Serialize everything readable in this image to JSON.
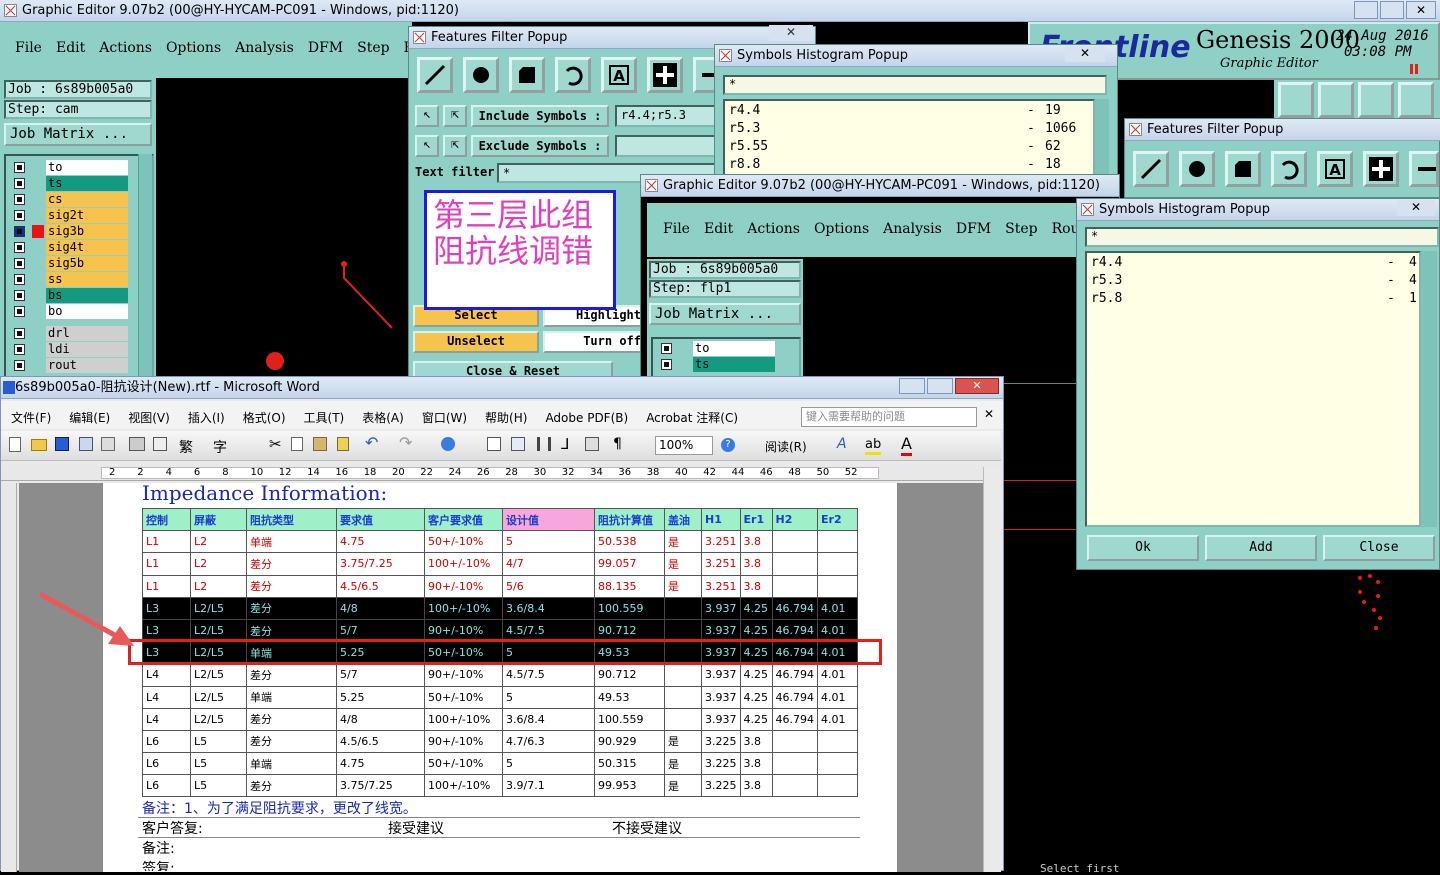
{
  "ge_main": {
    "title": "Graphic Editor 9.07b2 (00@HY-HYCAM-PC091 - Windows, pid:1120)",
    "menu": [
      "File",
      "Edit",
      "Actions",
      "Options",
      "Analysis",
      "DFM",
      "Step",
      "R"
    ],
    "job": "Job  :  6s89b005a0",
    "step": "Step:  cam",
    "job_matrix": "Job Matrix ...",
    "layers": [
      "to",
      "ts",
      "cs",
      "sig2t",
      "sig3b",
      "sig4t",
      "sig5b",
      "ss",
      "bs",
      "bo"
    ],
    "layers2": [
      "drl",
      "ldi",
      "rout"
    ]
  },
  "brand": {
    "logo": "Frontline",
    "product": "Genesis 2000",
    "subtitle": "Graphic Editor",
    "date": "24 Aug 2016",
    "time": "03:08 PM"
  },
  "ffp1": {
    "title": "Features Filter Popup",
    "include_label": "Include Symbols :",
    "include_value": "r4.4;r5.3",
    "exclude_label": "Exclude Symbols :",
    "text_filter_label": "Text filter",
    "text_filter_value": "*",
    "select": "Select",
    "highlight": "Highlight",
    "unselect": "Unselect",
    "turn_off": "Turn off",
    "close_reset": "Close & Reset"
  },
  "note": "第三层此组阻抗线调错",
  "hist1": {
    "title": "Symbols Histogram Popup",
    "filter": "*",
    "rows": [
      {
        "sym": "r4.4",
        "count": "19"
      },
      {
        "sym": "r5.3",
        "count": "1066"
      },
      {
        "sym": "r5.55",
        "count": "62"
      },
      {
        "sym": "r8.8",
        "count": "18"
      }
    ]
  },
  "ge2": {
    "title": "Graphic Editor 9.07b2 (00@HY-HYCAM-PC091 - Windows, pid:1120)",
    "menu": [
      "File",
      "Edit",
      "Actions",
      "Options",
      "Analysis",
      "DFM",
      "Step",
      "Rout"
    ],
    "job": "Job  :  6s89b005a0",
    "step": "Step:  flp1",
    "job_matrix": "Job Matrix ...",
    "layers": [
      "to",
      "ts"
    ]
  },
  "ffp2": {
    "title": "Features Filter Popup"
  },
  "hist2": {
    "title": "Symbols Histogram Popup",
    "filter": "*",
    "rows": [
      {
        "sym": "r4.4",
        "count": "4"
      },
      {
        "sym": "r5.3",
        "count": "4"
      },
      {
        "sym": "r5.8",
        "count": "1"
      }
    ],
    "ok": "Ok",
    "add": "Add",
    "close": "Close"
  },
  "word": {
    "title": "6s89b005a0-阻抗设计(New).rtf - Microsoft Word",
    "menu": [
      "文件(F)",
      "编辑(E)",
      "视图(V)",
      "插入(I)",
      "格式(O)",
      "工具(T)",
      "表格(A)",
      "窗口(W)",
      "帮助(H)",
      "Adobe PDF(B)",
      "Acrobat 注释(C)"
    ],
    "help_placeholder": "键入需要帮助的问题",
    "zoom": "100%",
    "read_btn": "阅读(R)",
    "ruler": [
      "2",
      "2",
      "4",
      "6",
      "8",
      "10",
      "12",
      "14",
      "16",
      "18",
      "20",
      "22",
      "24",
      "26",
      "28",
      "30",
      "32",
      "34",
      "36",
      "38",
      "40",
      "42",
      "44",
      "46",
      "48",
      "50",
      "52"
    ],
    "doc_heading": "Impedance Information:",
    "table_headers": [
      "控制",
      "屏蔽",
      "阻抗类型",
      "要求值",
      "客户要求值",
      "设计值",
      "阻抗计算值",
      "盖油",
      "H1",
      "Er1",
      "H2",
      "Er2"
    ],
    "rows": [
      [
        "L1",
        "L2",
        "单端",
        "4.75",
        "50+/-10%",
        "5",
        "50.538",
        "是",
        "3.251",
        "3.8",
        "",
        ""
      ],
      [
        "L1",
        "L2",
        "差分",
        "3.75/7.25",
        "100+/-10%",
        "4/7",
        "99.057",
        "是",
        "3.251",
        "3.8",
        "",
        ""
      ],
      [
        "L1",
        "L2",
        "差分",
        "4.5/6.5",
        "90+/-10%",
        "5/6",
        "88.135",
        "是",
        "3.251",
        "3.8",
        "",
        ""
      ],
      [
        "L3",
        "L2/L5",
        "差分",
        "4/8",
        "100+/-10%",
        "3.6/8.4",
        "100.559",
        "",
        "3.937",
        "4.25",
        "46.794",
        "4.01"
      ],
      [
        "L3",
        "L2/L5",
        "差分",
        "5/7",
        "90+/-10%",
        "4.5/7.5",
        "90.712",
        "",
        "3.937",
        "4.25",
        "46.794",
        "4.01"
      ],
      [
        "L3",
        "L2/L5",
        "单端",
        "5.25",
        "50+/-10%",
        "5",
        "49.53",
        "",
        "3.937",
        "4.25",
        "46.794",
        "4.01"
      ],
      [
        "L4",
        "L2/L5",
        "差分",
        "5/7",
        "90+/-10%",
        "4.5/7.5",
        "90.712",
        "",
        "3.937",
        "4.25",
        "46.794",
        "4.01"
      ],
      [
        "L4",
        "L2/L5",
        "单端",
        "5.25",
        "50+/-10%",
        "5",
        "49.53",
        "",
        "3.937",
        "4.25",
        "46.794",
        "4.01"
      ],
      [
        "L4",
        "L2/L5",
        "差分",
        "4/8",
        "100+/-10%",
        "3.6/8.4",
        "100.559",
        "",
        "3.937",
        "4.25",
        "46.794",
        "4.01"
      ],
      [
        "L6",
        "L5",
        "差分",
        "4.5/6.5",
        "90+/-10%",
        "4.7/6.3",
        "90.929",
        "是",
        "3.225",
        "3.8",
        "",
        ""
      ],
      [
        "L6",
        "L5",
        "单端",
        "4.75",
        "50+/-10%",
        "5",
        "50.315",
        "是",
        "3.225",
        "3.8",
        "",
        ""
      ],
      [
        "L6",
        "L5",
        "差分",
        "3.75/7.25",
        "100+/-10%",
        "3.9/7.1",
        "99.953",
        "是",
        "3.225",
        "3.8",
        "",
        ""
      ]
    ],
    "remark": "备注：1、为了满足阻抗要求，更改了线宽。",
    "reply_label": "客户答复:",
    "accept": "接受建议",
    "reject": "不接受建议",
    "remark2": "备注:",
    "sign": "签复:"
  },
  "bottom_right": "Select first",
  "colors": {
    "teal": "#8fd0c6",
    "highlight_box": "#e0201a",
    "table_header": "#9ff0c8",
    "dark_row_text": "#86e3e0",
    "note_text": "#e040c0"
  }
}
